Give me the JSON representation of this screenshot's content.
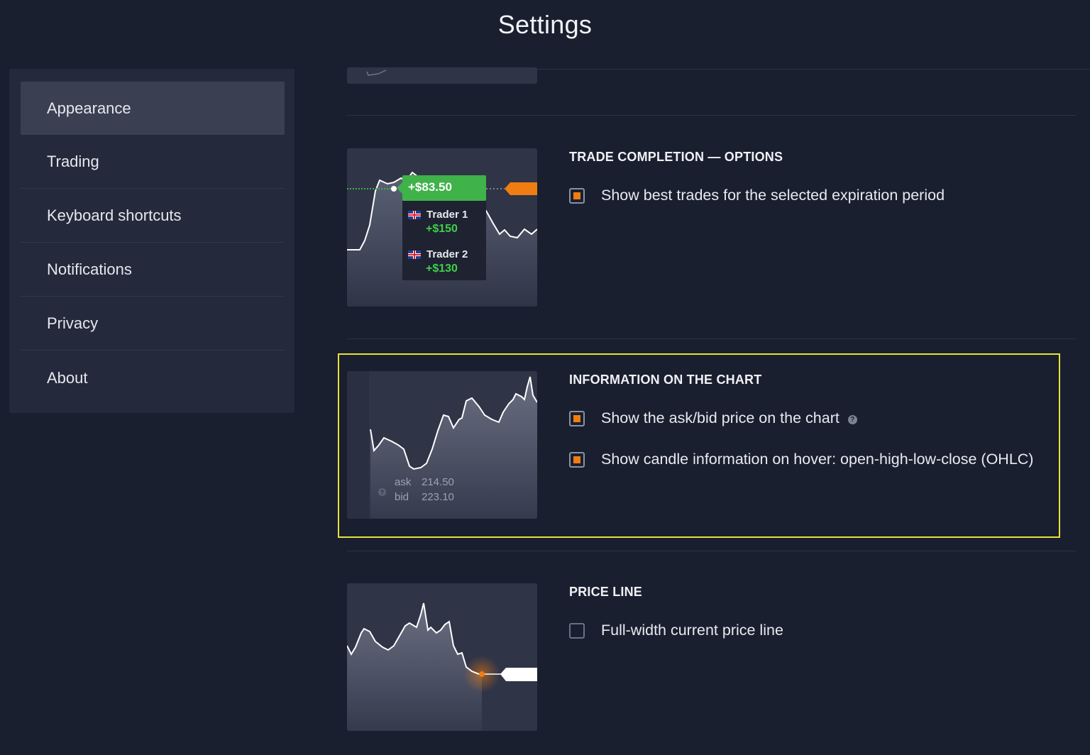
{
  "page": {
    "title": "Settings"
  },
  "sidebar": {
    "items": [
      {
        "label": "Appearance",
        "active": true
      },
      {
        "label": "Trading"
      },
      {
        "label": "Keyboard shortcuts"
      },
      {
        "label": "Notifications"
      },
      {
        "label": "Privacy"
      },
      {
        "label": "About"
      }
    ]
  },
  "sections": {
    "trade_completion": {
      "title": "TRADE COMPLETION — OPTIONS",
      "options": [
        {
          "label": "Show best trades for the selected expiration period",
          "checked": true
        }
      ],
      "preview": {
        "profit": "+$83.50",
        "traders": [
          {
            "name": "Trader 1",
            "amount": "+$150",
            "icon": "uk-flag-icon"
          },
          {
            "name": "Trader 2",
            "amount": "+$130",
            "icon": "uk-flag-icon"
          }
        ]
      }
    },
    "information_on_chart": {
      "title": "INFORMATION ON THE CHART",
      "options": [
        {
          "label": "Show the ask/bid price on the chart",
          "checked": true,
          "help": "?"
        },
        {
          "label": "Show candle information on hover: open-high-low-close (OHLC)",
          "checked": true
        }
      ],
      "preview": {
        "ask_label": "ask",
        "ask_value": "214.50",
        "bid_label": "bid",
        "bid_value": "223.10",
        "help": "?"
      }
    },
    "price_line": {
      "title": "PRICE LINE",
      "options": [
        {
          "label": "Full-width current price line",
          "checked": false
        }
      ]
    }
  },
  "colors": {
    "background": "#1a1f2f",
    "accent": "#f07d12",
    "profit": "#3fb24a",
    "highlight": "#e6e23a"
  }
}
